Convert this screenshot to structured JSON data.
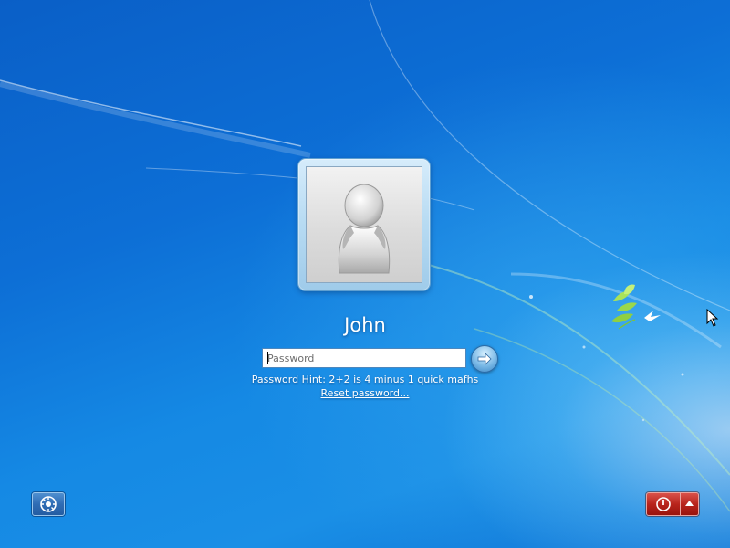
{
  "user": {
    "name": "John"
  },
  "password": {
    "value": "",
    "placeholder": "Password"
  },
  "hint": {
    "text": "Password Hint: 2+2 is 4 minus 1 quick mafhs"
  },
  "links": {
    "reset_password": "Reset password..."
  },
  "icons": {
    "avatar": "default-user-icon",
    "submit": "arrow-right-icon",
    "ease_of_access": "ease-of-access-icon",
    "power": "power-icon",
    "power_options": "chevron-up-icon",
    "wallpaper_logo": "bird-leaves-icon",
    "cursor": "mouse-pointer-icon"
  },
  "colors": {
    "background": "#0d6fd6",
    "power_button": "#b8241c",
    "ease_access_button": "#2f6cb4",
    "text": "#ffffff"
  }
}
